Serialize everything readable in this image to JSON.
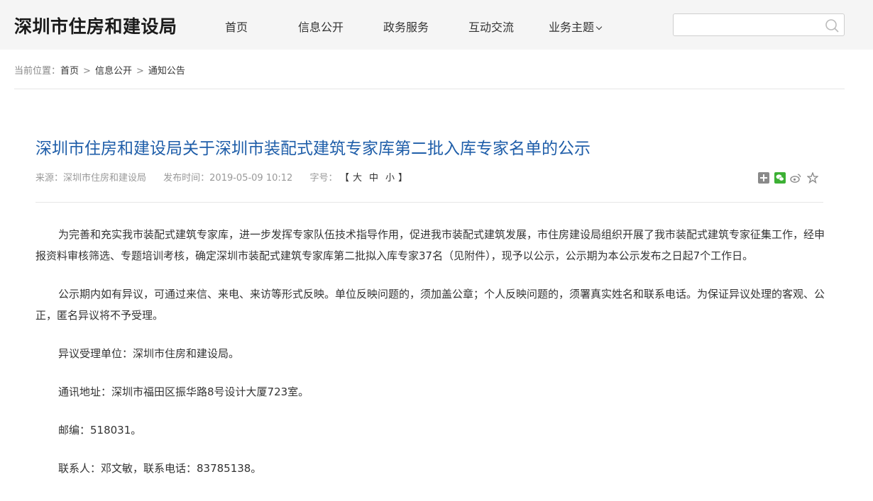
{
  "header": {
    "logo": "深圳市住房和建设局",
    "nav": [
      "首页",
      "信息公开",
      "政务服务",
      "互动交流",
      "业务主题"
    ],
    "search_placeholder": "",
    "icons": {
      "search": "search-icon",
      "dropdown": "chevron-down-icon"
    }
  },
  "breadcrumb": {
    "label": "当前位置：",
    "items": [
      "首页",
      "信息公开",
      "通知公告"
    ],
    "separator": ">"
  },
  "article": {
    "title": "深圳市住房和建设局关于深圳市装配式建筑专家库第二批入库专家名单的公示",
    "source": "来源：深圳市住房和建设局",
    "published": "发布时间：2019-05-09 10:12",
    "font_size_label": "字号：",
    "font_size_open": "【",
    "font_size_close": "】",
    "font_sizes": [
      "大",
      "中",
      "小"
    ],
    "share_icons": [
      "plus-share-icon",
      "wechat-icon",
      "weibo-icon",
      "favorite-icon"
    ],
    "paragraphs": [
      "为完善和充实我市装配式建筑专家库，进一步发挥专家队伍技术指导作用，促进我市装配式建筑发展，市住房建设局组织开展了我市装配式建筑专家征集工作，经申报资料审核筛选、专题培训考核，确定深圳市装配式建筑专家库第二批拟入库专家37名（见附件），现予以公示，公示期为本公示发布之日起7个工作日。",
      "公示期内如有异议，可通过来信、来电、来访等形式反映。单位反映问题的，须加盖公章；个人反映问题的，须署真实姓名和联系电话。为保证异议处理的客观、公正，匿名异议将不予受理。",
      "异议受理单位：深圳市住房和建设局。",
      "通讯地址：深圳市福田区振华路8号设计大厦723室。",
      "邮编：518031。",
      "联系人：邓文敏，联系电话：83785138。"
    ]
  },
  "colors": {
    "title": "#1f5ea9",
    "header_bg": "#f5f5f5",
    "wechat": "#3cb034"
  }
}
